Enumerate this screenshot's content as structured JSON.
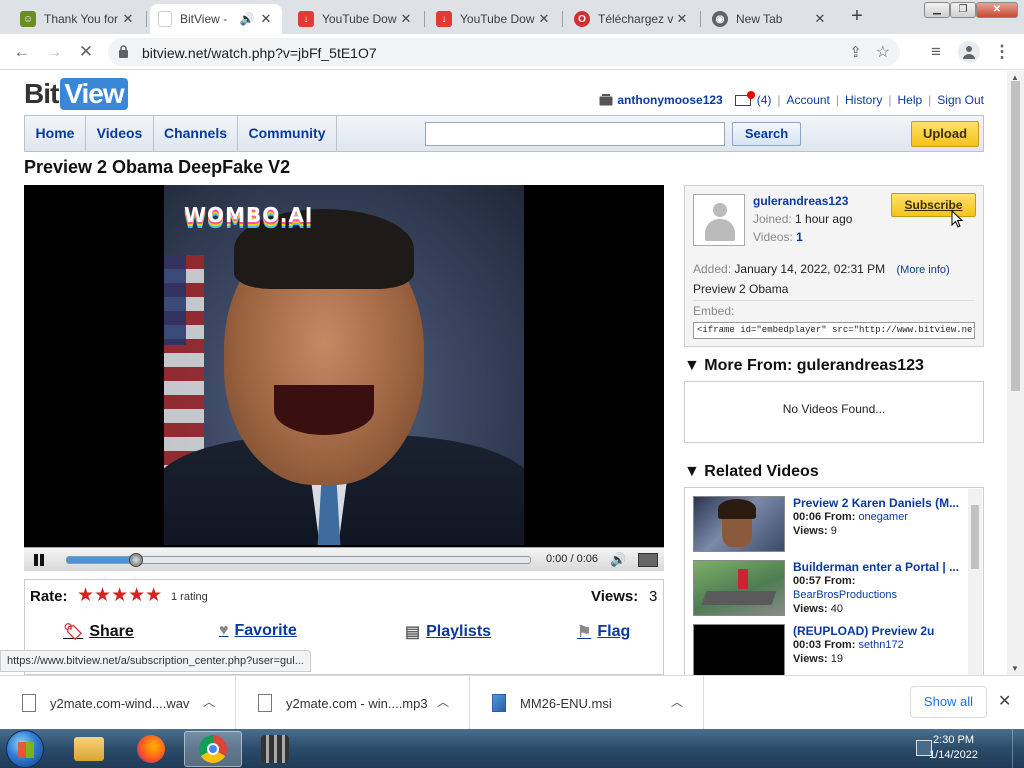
{
  "browser": {
    "tabs": [
      {
        "title": "Thank You for",
        "icon": "smiley-icon",
        "active": false
      },
      {
        "title": "BitView -",
        "icon": "bitview-icon",
        "active": true,
        "audio": "speaker-icon"
      },
      {
        "title": "YouTube Dow",
        "icon": "download-icon",
        "active": false
      },
      {
        "title": "YouTube Dow",
        "icon": "download-icon",
        "active": false
      },
      {
        "title": "Téléchargez v",
        "icon": "opera-icon",
        "active": false
      },
      {
        "title": "New Tab",
        "icon": "chrome-icon",
        "active": false
      }
    ],
    "url": "bitview.net/watch.php?v=jbFf_5tE1O7",
    "status_url": "https://www.bitview.net/a/subscription_center.php?user=gul..."
  },
  "site": {
    "logo_bit": "Bit",
    "logo_view": "View",
    "user": {
      "username": "anthonymoose123",
      "inbox_count": "(4)",
      "links": [
        "Account",
        "History",
        "Help",
        "Sign Out"
      ]
    },
    "nav": [
      "Home",
      "Videos",
      "Channels",
      "Community"
    ],
    "search_button": "Search",
    "upload_button": "Upload"
  },
  "video": {
    "title": "Preview 2 Obama DeepFake V2",
    "watermark": "WOMBO.AI",
    "time": "0:00 / 0:06",
    "progress": 0.15,
    "rate_label": "Rate:",
    "stars": "★★★★★",
    "rating_count": "1 rating",
    "views_label": "Views:",
    "views": "3",
    "actions": {
      "share": "Share",
      "favorite": "Favorite",
      "playlists": "Playlists",
      "flag": "Flag"
    }
  },
  "uploader": {
    "name": "gulerandreas123",
    "joined_label": "Joined:",
    "joined": "1 hour ago",
    "videos_label": "Videos:",
    "videos": "1",
    "subscribe": "Subscribe",
    "added_label": "Added:",
    "added": "January 14, 2022, 02:31 PM",
    "more_info": "(More info)",
    "description": "Preview 2 Obama",
    "embed_label": "Embed:",
    "embed_code": "<iframe id=\"embedplayer\" src=\"http://www.bitview.net/embed.p"
  },
  "more_from": {
    "title": "More From: gulerandreas123",
    "empty": "No Videos Found..."
  },
  "related": {
    "title": "Related Videos",
    "items": [
      {
        "title": "Preview 2 Karen Daniels (M...",
        "duration": "00:06",
        "from_label": "From:",
        "from": "onegamer",
        "views_label": "Views:",
        "views": "9"
      },
      {
        "title": "Builderman enter a Portal | ...",
        "duration": "00:57",
        "from_label": "From:",
        "from": "BearBrosProductions",
        "views_label": "Views:",
        "views": "40"
      },
      {
        "title": "(REUPLOAD) Preview 2u",
        "duration": "00:03",
        "from_label": "From:",
        "from": "sethn172",
        "views_label": "Views:",
        "views": "19"
      }
    ]
  },
  "downloads": {
    "items": [
      {
        "name": "y2mate.com-wind....wav"
      },
      {
        "name": "y2mate.com - win....mp3"
      },
      {
        "name": "MM26-ENU.msi"
      }
    ],
    "show_all": "Show all"
  },
  "taskbar": {
    "time": "2:30 PM",
    "date": "1/14/2022"
  }
}
